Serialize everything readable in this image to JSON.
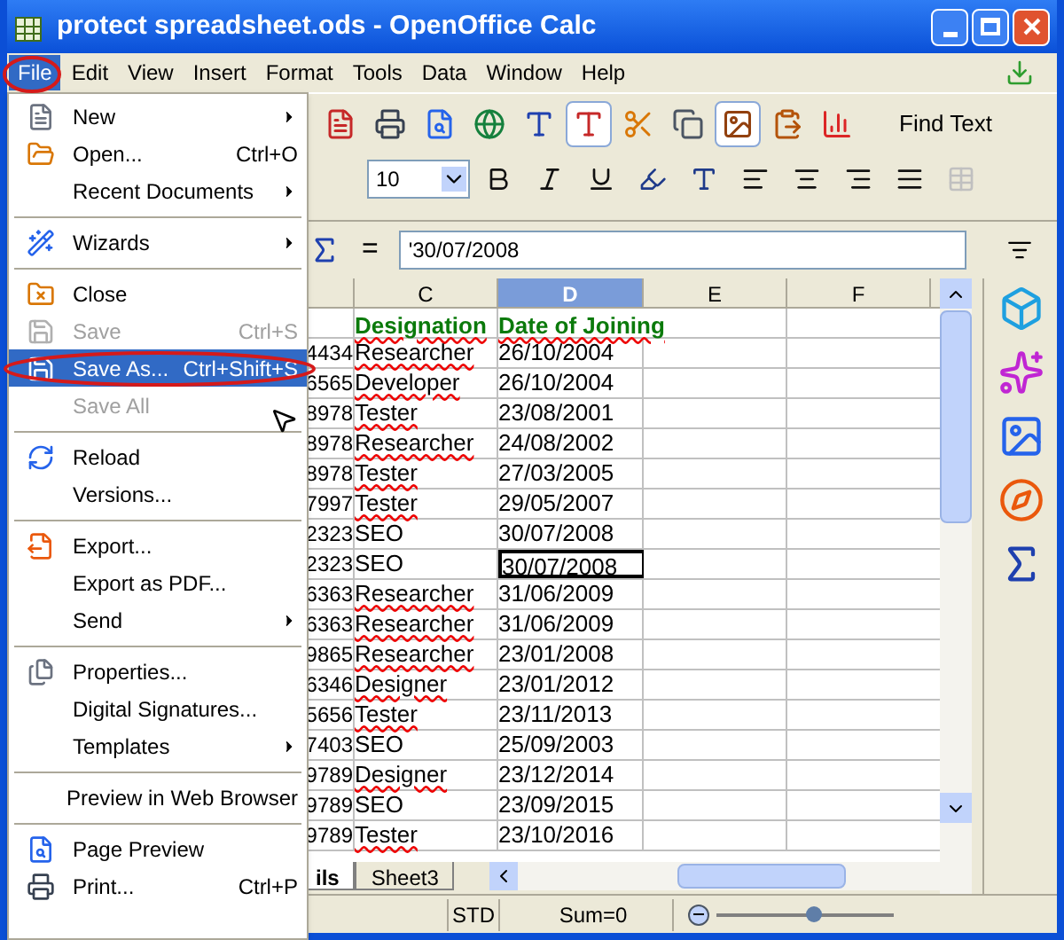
{
  "window": {
    "title": "protect spreadsheet.ods - OpenOffice Calc"
  },
  "menubar": [
    {
      "label": "File",
      "selected": true
    },
    {
      "label": "Edit",
      "selected": false
    },
    {
      "label": "View",
      "selected": false
    },
    {
      "label": "Insert",
      "selected": false
    },
    {
      "label": "Format",
      "selected": false
    },
    {
      "label": "Tools",
      "selected": false
    },
    {
      "label": "Data",
      "selected": false
    },
    {
      "label": "Window",
      "selected": false
    },
    {
      "label": "Help",
      "selected": false
    }
  ],
  "file_menu": [
    {
      "kind": "item",
      "label": "New",
      "submenu": true,
      "disabled": false,
      "selected": false
    },
    {
      "kind": "item",
      "label": "Open...",
      "shortcut": "Ctrl+O",
      "submenu": false,
      "disabled": false,
      "selected": false
    },
    {
      "kind": "item",
      "label": "Recent Documents",
      "submenu": true,
      "disabled": false,
      "selected": false
    },
    {
      "kind": "separator"
    },
    {
      "kind": "item",
      "label": "Wizards",
      "submenu": true,
      "disabled": false,
      "selected": false
    },
    {
      "kind": "separator"
    },
    {
      "kind": "item",
      "label": "Close",
      "submenu": false,
      "disabled": false,
      "selected": false
    },
    {
      "kind": "item",
      "label": "Save",
      "shortcut": "Ctrl+S",
      "submenu": false,
      "disabled": true,
      "selected": false
    },
    {
      "kind": "item",
      "label": "Save As...",
      "shortcut": "Ctrl+Shift+S",
      "submenu": false,
      "disabled": false,
      "selected": true
    },
    {
      "kind": "item",
      "label": "Save All",
      "submenu": false,
      "disabled": true,
      "selected": false
    },
    {
      "kind": "separator"
    },
    {
      "kind": "item",
      "label": "Reload",
      "submenu": false,
      "disabled": false,
      "selected": false
    },
    {
      "kind": "item",
      "label": "Versions...",
      "submenu": false,
      "disabled": false,
      "selected": false
    },
    {
      "kind": "separator"
    },
    {
      "kind": "item",
      "label": "Export...",
      "submenu": false,
      "disabled": false,
      "selected": false
    },
    {
      "kind": "item",
      "label": "Export as PDF...",
      "submenu": false,
      "disabled": false,
      "selected": false
    },
    {
      "kind": "item",
      "label": "Send",
      "submenu": true,
      "disabled": false,
      "selected": false
    },
    {
      "kind": "separator"
    },
    {
      "kind": "item",
      "label": "Properties...",
      "submenu": false,
      "disabled": false,
      "selected": false
    },
    {
      "kind": "item",
      "label": "Digital Signatures...",
      "submenu": false,
      "disabled": false,
      "selected": false
    },
    {
      "kind": "item",
      "label": "Templates",
      "submenu": true,
      "disabled": false,
      "selected": false
    },
    {
      "kind": "separator"
    },
    {
      "kind": "item",
      "label": "Preview in Web Browser",
      "submenu": false,
      "disabled": false,
      "selected": false
    },
    {
      "kind": "separator"
    },
    {
      "kind": "item",
      "label": "Page Preview",
      "submenu": false,
      "disabled": false,
      "selected": false
    },
    {
      "kind": "item",
      "label": "Print...",
      "shortcut": "Ctrl+P",
      "submenu": false,
      "disabled": false,
      "selected": false
    }
  ],
  "find_toolbar": {
    "label": "Find Text"
  },
  "formatting": {
    "font_size": "10"
  },
  "formula_bar": {
    "equals": "=",
    "value": "'30/07/2008"
  },
  "columns": [
    {
      "label": "C",
      "selected": false
    },
    {
      "label": "D",
      "selected": true
    },
    {
      "label": "E",
      "selected": false
    },
    {
      "label": "F",
      "selected": false
    }
  ],
  "header_row": {
    "c": "Designation",
    "d": "Date of Joining"
  },
  "rows": [
    {
      "b": "4434",
      "c": "Researcher",
      "flagged": true,
      "d": "26/10/2004",
      "selected": false
    },
    {
      "b": "6565",
      "c": "Developer",
      "flagged": true,
      "d": "26/10/2004",
      "selected": false
    },
    {
      "b": "8978",
      "c": "Tester",
      "flagged": true,
      "d": "23/08/2001",
      "selected": false
    },
    {
      "b": "8978",
      "c": "Researcher",
      "flagged": true,
      "d": "24/08/2002",
      "selected": false
    },
    {
      "b": "8978",
      "c": "Tester",
      "flagged": true,
      "d": "27/03/2005",
      "selected": false
    },
    {
      "b": "7997",
      "c": "Tester",
      "flagged": true,
      "d": "29/05/2007",
      "selected": false
    },
    {
      "b": "2323",
      "c": "SEO",
      "flagged": false,
      "d": "30/07/2008",
      "selected": false
    },
    {
      "b": "2323",
      "c": "SEO",
      "flagged": false,
      "d": "30/07/2008",
      "selected": true
    },
    {
      "b": "6363",
      "c": "Researcher",
      "flagged": true,
      "d": "31/06/2009",
      "selected": false
    },
    {
      "b": "6363",
      "c": "Researcher",
      "flagged": true,
      "d": "31/06/2009",
      "selected": false
    },
    {
      "b": "9865",
      "c": "Researcher",
      "flagged": true,
      "d": "23/01/2008",
      "selected": false
    },
    {
      "b": "6346",
      "c": "Designer",
      "flagged": true,
      "d": "23/01/2012",
      "selected": false
    },
    {
      "b": "5656",
      "c": "Tester",
      "flagged": true,
      "d": "23/11/2013",
      "selected": false
    },
    {
      "b": "7403",
      "c": "SEO",
      "flagged": false,
      "d": "25/09/2003",
      "selected": false
    },
    {
      "b": "9789",
      "c": "Designer",
      "flagged": true,
      "d": "23/12/2014",
      "selected": false
    },
    {
      "b": "9789",
      "c": "SEO",
      "flagged": false,
      "d": "23/09/2015",
      "selected": false
    },
    {
      "b": "9789",
      "c": "Tester",
      "flagged": true,
      "d": "23/10/2016",
      "selected": false
    }
  ],
  "sheet_tabs": [
    {
      "label": "ils",
      "selected": true
    },
    {
      "label": "Sheet3",
      "selected": false
    }
  ],
  "status_bar": {
    "mode": "STD",
    "sum": "Sum=0",
    "zoom": {
      "level": 0.55
    }
  }
}
